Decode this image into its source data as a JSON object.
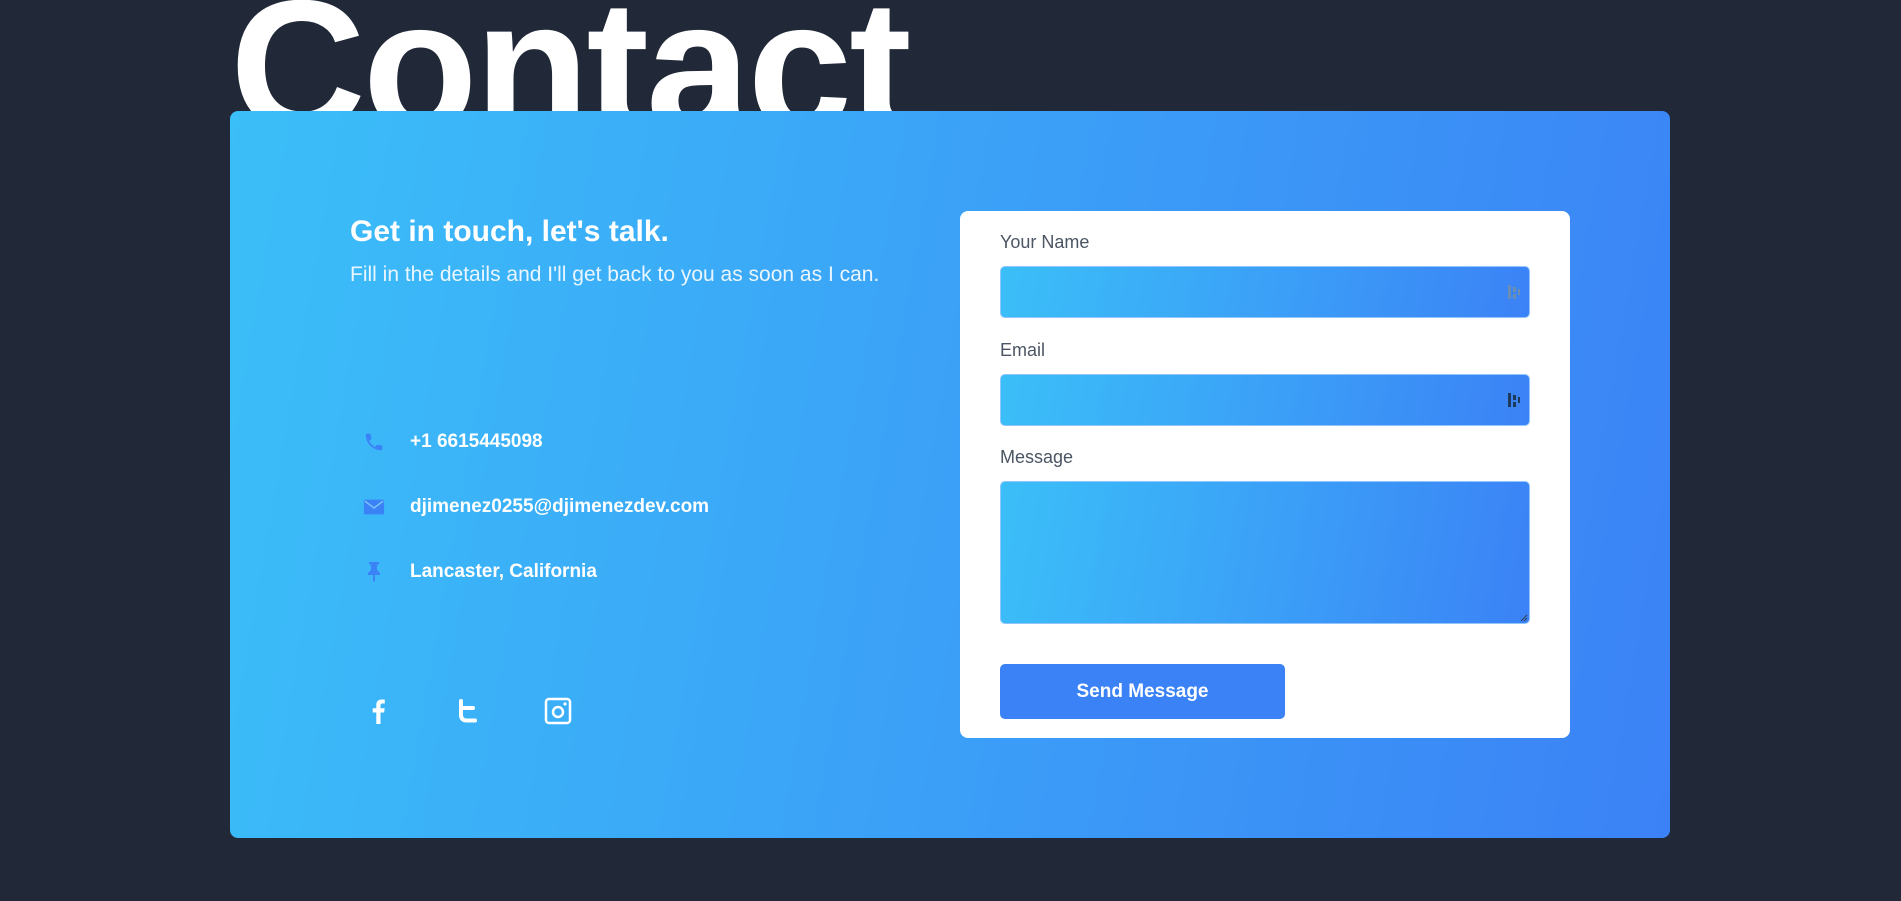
{
  "page": {
    "title": "Contact"
  },
  "intro": {
    "headline": "Get in touch, let's talk.",
    "subheadline": "Fill in the details and I'll get back to you as soon as I can."
  },
  "contact_info": [
    {
      "icon": "phone-icon",
      "text": "+1 6615445098"
    },
    {
      "icon": "mail-icon",
      "text": "djimenez0255@djimenezdev.com"
    },
    {
      "icon": "pin-icon",
      "text": "Lancaster, California"
    }
  ],
  "social": [
    {
      "icon": "facebook-icon"
    },
    {
      "icon": "twitter-icon"
    },
    {
      "icon": "instagram-icon"
    }
  ],
  "form": {
    "name_label": "Your Name",
    "name_value": "",
    "email_label": "Email",
    "email_value": "",
    "message_label": "Message",
    "message_value": "",
    "submit_label": "Send Message"
  },
  "colors": {
    "page_background": "#212938",
    "gradient_start": "#3bbff8",
    "gradient_end": "#3b82f6",
    "button": "#3b82f6",
    "form_background": "#ffffff"
  }
}
